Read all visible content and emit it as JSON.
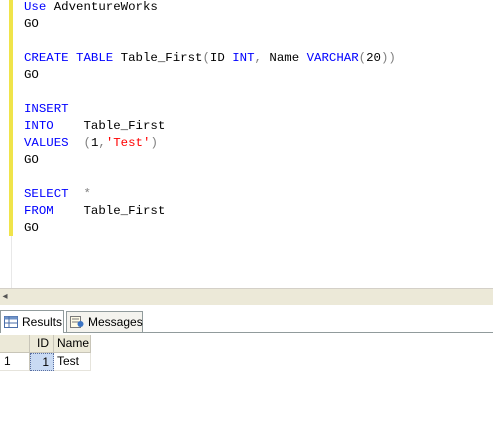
{
  "editor": {
    "lines": [
      [
        {
          "t": "Use ",
          "c": "kw"
        },
        {
          "t": "AdventureWorks",
          "c": "tx"
        }
      ],
      [
        {
          "t": "GO",
          "c": "tx"
        }
      ],
      [],
      [
        {
          "t": "CREATE TABLE ",
          "c": "kw"
        },
        {
          "t": "Table_First",
          "c": "tx"
        },
        {
          "t": "(",
          "c": "gr"
        },
        {
          "t": "ID ",
          "c": "tx"
        },
        {
          "t": "INT",
          "c": "kw"
        },
        {
          "t": ", ",
          "c": "gr"
        },
        {
          "t": "Name ",
          "c": "tx"
        },
        {
          "t": "VARCHAR",
          "c": "kw"
        },
        {
          "t": "(",
          "c": "gr"
        },
        {
          "t": "20",
          "c": "tx"
        },
        {
          "t": "))",
          "c": "gr"
        }
      ],
      [
        {
          "t": "GO",
          "c": "tx"
        }
      ],
      [],
      [
        {
          "t": "INSERT",
          "c": "kw"
        }
      ],
      [
        {
          "t": "INTO",
          "c": "kw"
        },
        {
          "t": "    Table_First",
          "c": "tx"
        }
      ],
      [
        {
          "t": "VALUES",
          "c": "kw"
        },
        {
          "t": "  (",
          "c": "gr"
        },
        {
          "t": "1",
          "c": "tx"
        },
        {
          "t": ",",
          "c": "gr"
        },
        {
          "t": "'Test'",
          "c": "st"
        },
        {
          "t": ")",
          "c": "gr"
        }
      ],
      [
        {
          "t": "GO",
          "c": "tx"
        }
      ],
      [],
      [
        {
          "t": "SELECT",
          "c": "kw"
        },
        {
          "t": "  *",
          "c": "gr"
        }
      ],
      [
        {
          "t": "FROM",
          "c": "kw"
        },
        {
          "t": "    Table_First",
          "c": "tx"
        }
      ],
      [
        {
          "t": "GO",
          "c": "tx"
        }
      ]
    ]
  },
  "tabs": {
    "results_label": "Results",
    "messages_label": "Messages"
  },
  "grid": {
    "columns": [
      "ID",
      "Name"
    ],
    "rows": [
      {
        "row_number": "1",
        "cells": [
          "1",
          "Test"
        ]
      }
    ]
  }
}
